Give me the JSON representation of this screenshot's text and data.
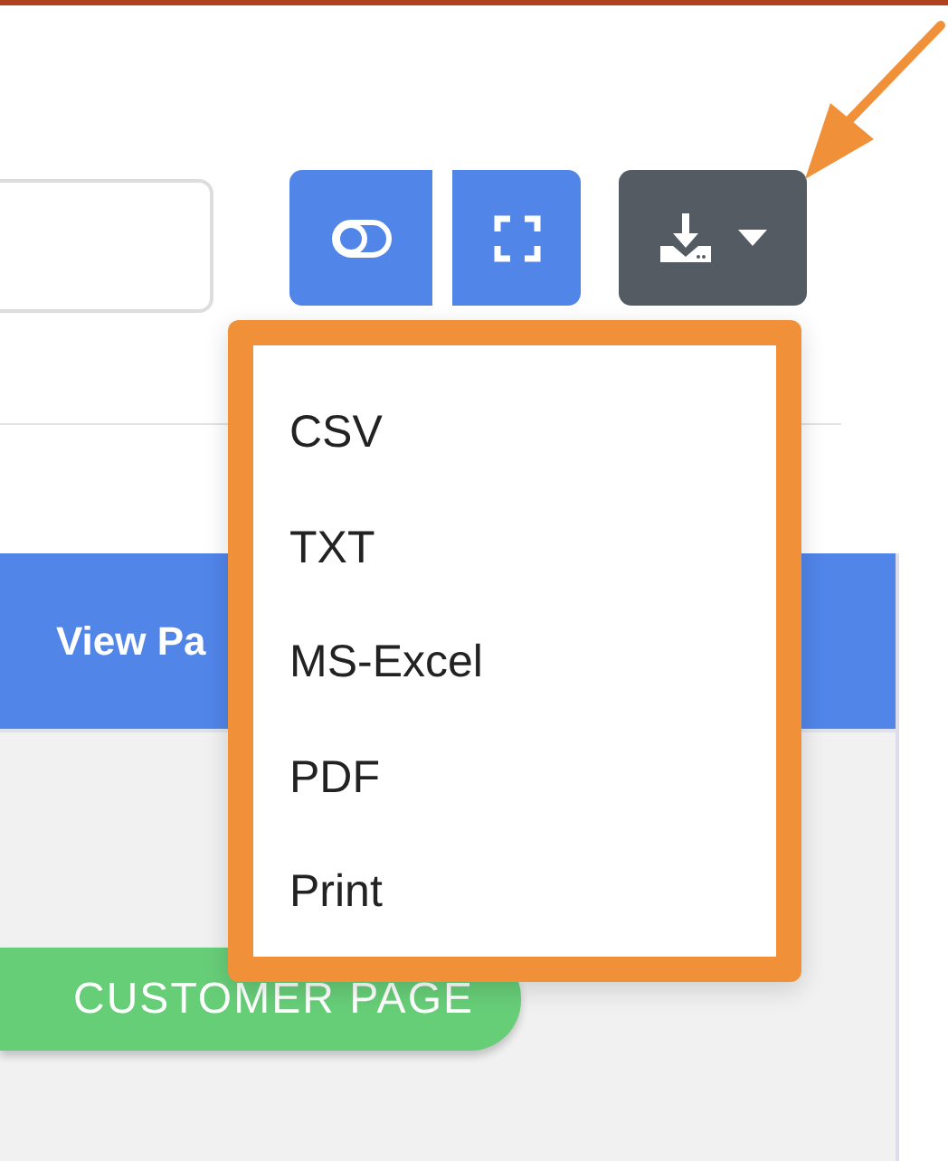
{
  "toolbar": {
    "export_menu": {
      "expanded": true,
      "items": [
        {
          "label": "CSV"
        },
        {
          "label": "TXT"
        },
        {
          "label": "MS-Excel"
        },
        {
          "label": "PDF"
        },
        {
          "label": "Print"
        }
      ]
    }
  },
  "table": {
    "header": "View Pa",
    "row_button": "CUSTOMER PAGE"
  }
}
